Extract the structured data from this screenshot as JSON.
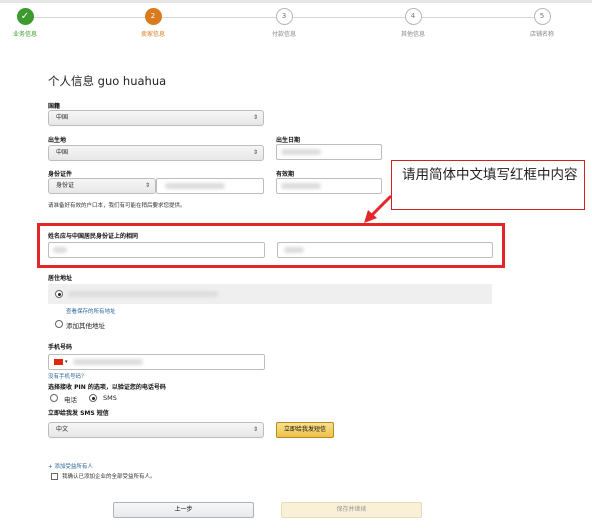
{
  "steps": [
    {
      "number": "✓",
      "label": "业务信息"
    },
    {
      "number": "2",
      "label": "卖家信息"
    },
    {
      "number": "3",
      "label": "付款信息"
    },
    {
      "number": "4",
      "label": "其他信息"
    },
    {
      "number": "5",
      "label": "店铺名称"
    }
  ],
  "page_title": "个人信息 guo huahua",
  "nationality": {
    "label": "国籍",
    "value": "中国"
  },
  "birthplace": {
    "label": "出生地",
    "value": "中国"
  },
  "birthdate": {
    "label": "出生日期"
  },
  "id_doc": {
    "label": "身份证件",
    "type_value": "身份证"
  },
  "expiry": {
    "label": "有效期"
  },
  "id_note": "请准备好有效的户口本，我们有可能在稍后要求您提供。",
  "name_section": {
    "label": "姓名应与中国居民身份证上的相同"
  },
  "callout": "请用简体中文填写红框中内容",
  "residence": {
    "label": "居住地址",
    "view_all_link": "查看保存的所有地址",
    "add_other": "添加其他地址"
  },
  "phone": {
    "label": "手机号码",
    "flag_caret": "▾",
    "no_phone_link": "没有手机号码？",
    "pin_label": "选择接收 PIN 的选项，以验证您的电话号码",
    "options": [
      "电话",
      "SMS"
    ],
    "sms_label": "立即给我发 SMS 短信",
    "language": "中文",
    "send_button": "立即给我发短信"
  },
  "beneficiary": {
    "add_link": "+ 添加受益所有人",
    "confirm": "我确认已添加企业的全部受益所有人。"
  },
  "buttons": {
    "prev": "上一步",
    "save": "保存并继续"
  },
  "select_arrow": "⇕",
  "colors": {
    "done": "#3c9a2e",
    "active": "#d97b1c",
    "highlight": "#e3262a",
    "primary_button": "#f0c14b"
  }
}
